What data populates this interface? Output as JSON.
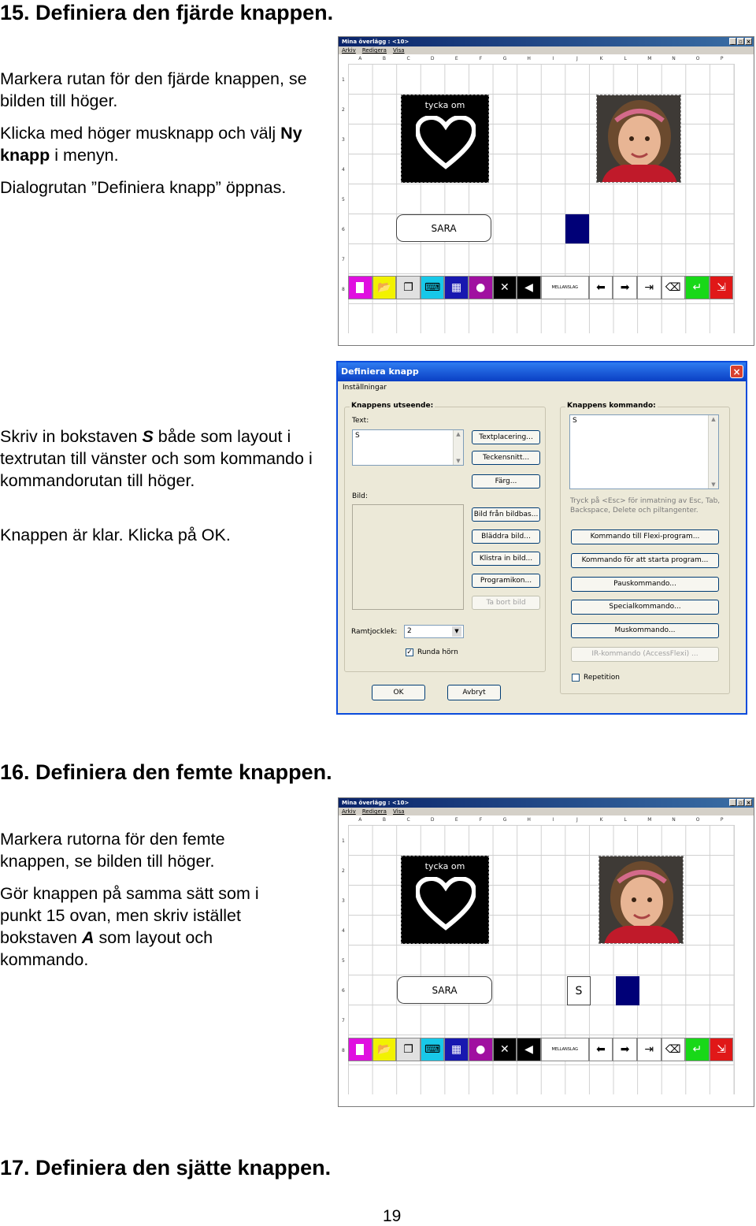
{
  "section15": {
    "heading": "15. Definiera den fjärde knappen.",
    "p1": "Markera rutan för den fjärde knappen, se bilden till höger.",
    "p2_a": "Klicka med höger musknapp och välj ",
    "p2_bold": "Ny knapp",
    "p2_b": " i menyn.",
    "p3": "Dialogrutan ”Definiera knapp” öppnas.",
    "p4_a": "Skriv in bokstaven ",
    "p4_bold": "S",
    "p4_b": " både som layout i textrutan till vänster och som kommando i kommandorutan till höger.",
    "p5": "Knappen är klar. Klicka på OK."
  },
  "section16": {
    "heading": "16. Definiera den femte knappen.",
    "p1": "Markera rutorna för den femte knappen, se bilden till höger.",
    "p2_a": "Gör knappen på samma sätt som i punkt 15 ovan, men skriv istället bokstaven ",
    "p2_bold": "A",
    "p2_b": " som layout och kommando."
  },
  "section17": {
    "heading": "17. Definiera den sjätte knappen."
  },
  "page_number": "19",
  "app_window": {
    "title": "Mina överlägg : <10>",
    "title_buttons": [
      "_",
      "▫",
      "×"
    ],
    "menu": [
      "Arkiv",
      "Redigera",
      "Visa"
    ],
    "columns": [
      "A",
      "B",
      "C",
      "D",
      "E",
      "F",
      "G",
      "H",
      "I",
      "J",
      "K",
      "L",
      "M",
      "N",
      "O",
      "P"
    ],
    "rows": [
      "1",
      "2",
      "3",
      "4",
      "5",
      "6",
      "7",
      "8"
    ],
    "heart_caption": "tycka om",
    "name_button": "SARA",
    "new_button_label": "S",
    "toolbar_label": "MELLANSLAG",
    "navy_color": "#000077"
  },
  "dialog": {
    "title": "Definiera knapp",
    "close": "×",
    "tab": "Inställningar",
    "appearance_group": "Knappens utseende:",
    "text_label": "Text:",
    "text_value": "S",
    "image_label": "Bild:",
    "buttons_left": [
      "Textplacering...",
      "Teckensnitt...",
      "Färg...",
      "Bild från bildbas...",
      "Bläddra bild...",
      "Klistra in bild...",
      "Programikon...",
      "Ta bort bild"
    ],
    "frame_label": "Ramtjocklek:",
    "frame_value": "2",
    "round_corners": "Runda hörn",
    "command_group": "Knappens kommando:",
    "command_value": "S",
    "hint": "Tryck på <Esc> för inmatning av Esc, Tab, Backspace, Delete och piltangenter.",
    "buttons_right": [
      "Kommando till Flexi-program...",
      "Kommando för att starta program...",
      "Pauskommando...",
      "Specialkommando...",
      "Muskommando...",
      "IR-kommando (AccessFlexi) ..."
    ],
    "repetition": "Repetition",
    "ok": "OK",
    "cancel": "Avbryt"
  }
}
